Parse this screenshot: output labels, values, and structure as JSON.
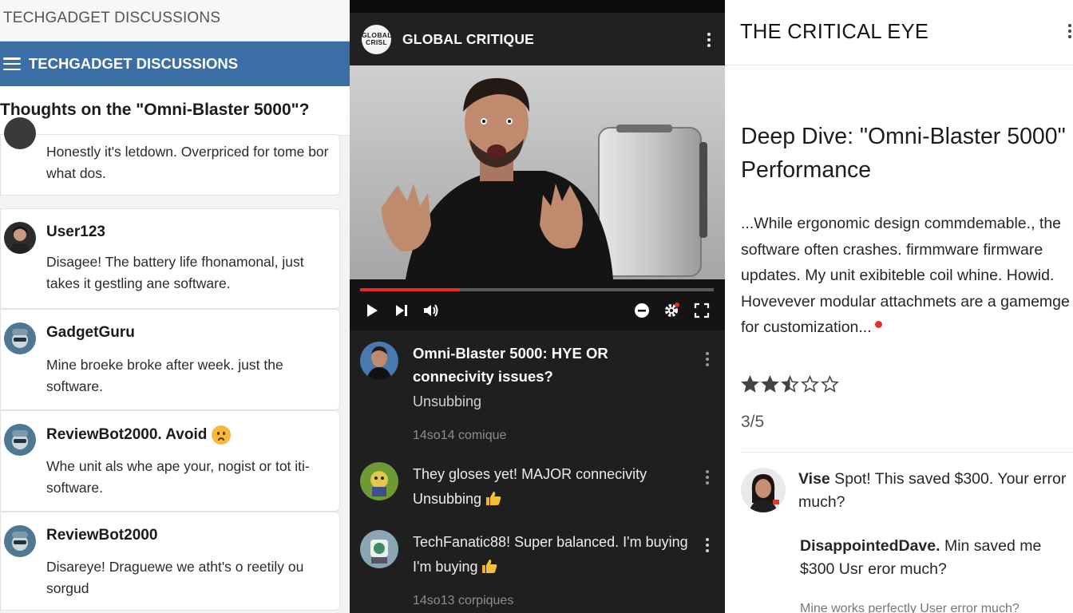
{
  "forum": {
    "topbar_title": "TECHGADGET DISCUSSIONS",
    "nav_title": "TECHGADGET DISCUSSIONS",
    "thread_title": "Thoughts on the \"Omni-Blaster 5000\"?",
    "posts": [
      {
        "user": "",
        "body": "Honestly it's letdown. Overpriced for tome bor what dos."
      },
      {
        "user": "User123",
        "body": "Disagee! The battery life fhonamonal, just takes it gestling ane software."
      },
      {
        "user": "GadgetGuru",
        "body": "Mine broeke broke after week. just the software."
      },
      {
        "user": "ReviewBot2000. Avoid",
        "body": "Whe unit als whe ape your, nogist or tot iti-software."
      },
      {
        "user": "ReviewBot2000",
        "body": "Disareye! Draguewe we atht's o reetily ou sorgud"
      }
    ]
  },
  "video": {
    "channel_logo_text": "GLOBAL CRISL",
    "channel_name": "GLOBAL CRITIQUE",
    "progress": 0.28,
    "featured": {
      "title": "Omni-Blaster 5000: HYE OR connecivity issues?",
      "subtitle": "Unsubbing",
      "meta": "14so14 comique"
    },
    "comments": [
      {
        "text_line1": "They gloses yet! MAJOR connecivity",
        "text_line2": "Unsubbing"
      },
      {
        "text_line1": "TechFanatic88! Super balanced. I'm buying",
        "text_line2": "I'm buying"
      }
    ],
    "bottom_meta": "14so13 corpiques",
    "accent_color": "#e52d27"
  },
  "article": {
    "brand": "THE CRITICAL EYE",
    "title": "Deep Dive: \"Omni-Blaster 5000\" Performance",
    "body_lines": [
      "...While ergonomic design commdemable., the",
      "software often crashes.  firmmware firmware",
      "updates. My unit exibiteble coil whine. Howid.",
      "Hovevever modular attachmets are a gamemge",
      "for customization..."
    ],
    "rating_value": 2.5,
    "rating_max": 5,
    "rating_text": "3/5",
    "comment1_bold": "Vise",
    "comment1_rest": " Spot! This saved $300. Your error much?",
    "comment2_bold": "DisappointedDave.",
    "comment2_rest": " Min saved me $300 Usг eror much?",
    "comment3": "Mine works perfectly User error much?"
  }
}
